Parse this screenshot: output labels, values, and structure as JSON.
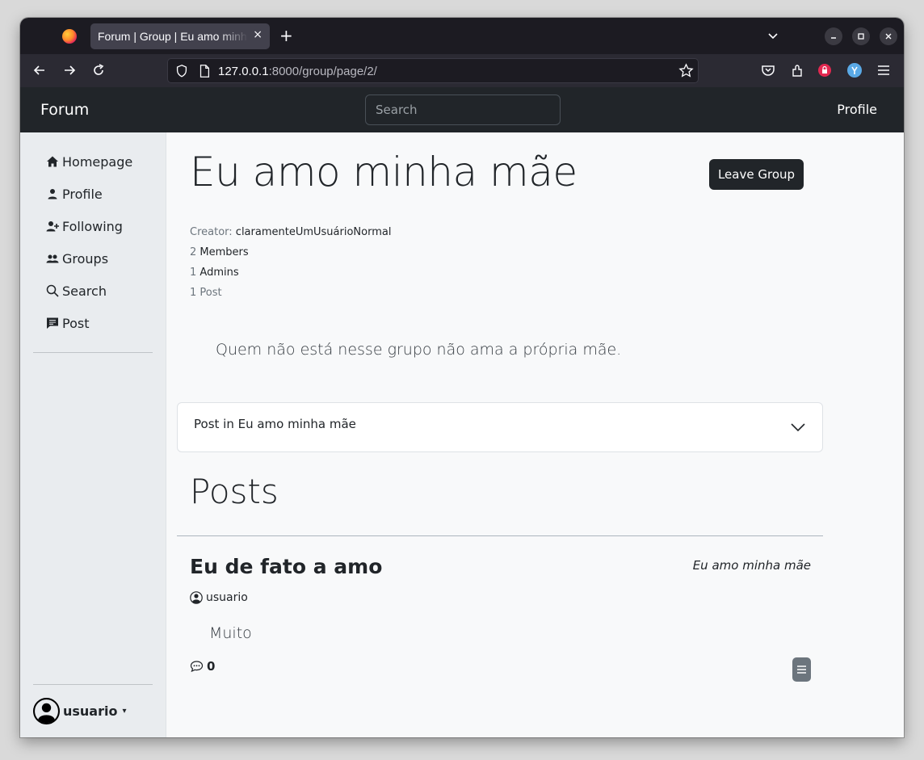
{
  "browser": {
    "tab_title": "Forum | Group | Eu amo minha mãe",
    "tab_close": "×",
    "new_tab": "+",
    "url_host": "127.0.0.1",
    "url_rest": ":8000/group/page/2/"
  },
  "topnav": {
    "brand": "Forum",
    "search_placeholder": "Search",
    "profile": "Profile"
  },
  "sidebar": {
    "items": [
      {
        "label": "Homepage",
        "icon": "house-icon"
      },
      {
        "label": "Profile",
        "icon": "person-icon"
      },
      {
        "label": "Following",
        "icon": "person-plus-icon"
      },
      {
        "label": "Groups",
        "icon": "people-icon"
      },
      {
        "label": "Search",
        "icon": "search-icon"
      },
      {
        "label": "Post",
        "icon": "message-square-icon"
      }
    ],
    "user": "usuario"
  },
  "group": {
    "title": "Eu amo minha mãe",
    "leave_button": "Leave Group",
    "creator_label": "Creator:",
    "creator": "claramenteUmUsuárioNormal",
    "members_count": "2",
    "members_label": "Members",
    "admins_count": "1",
    "admins_label": "Admins",
    "posts_count_text": "1 Post",
    "description": "Quem não está nesse grupo não ama a própria mãe.",
    "accordion_label": "Post in Eu amo minha mãe"
  },
  "posts": {
    "heading": "Posts",
    "items": [
      {
        "title": "Eu de fato a amo",
        "group": "Eu amo minha mãe",
        "author": "usuario",
        "body": "Muito",
        "comments": "0"
      }
    ]
  }
}
